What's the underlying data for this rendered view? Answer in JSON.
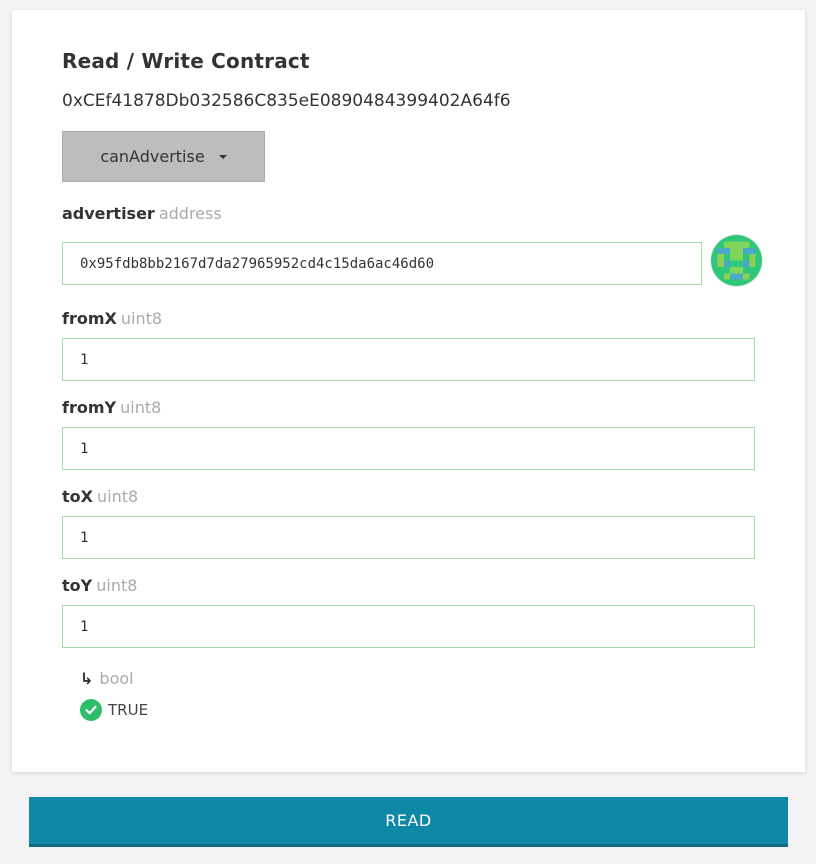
{
  "card": {
    "title": "Read / Write Contract",
    "contract_address": "0xCEf41878Db032586C835eE0890484399402A64f6",
    "function_select": "canAdvertise"
  },
  "params": [
    {
      "name": "advertiser",
      "type": "address",
      "value": "0x95fdb8bb2167d7da27965952cd4c15da6ac46d60"
    },
    {
      "name": "fromX",
      "type": "uint8",
      "value": "1"
    },
    {
      "name": "fromY",
      "type": "uint8",
      "value": "1"
    },
    {
      "name": "toX",
      "type": "uint8",
      "value": "1"
    },
    {
      "name": "toY",
      "type": "uint8",
      "value": "1"
    }
  ],
  "output": {
    "arrow": "↳",
    "type": "bool",
    "value": "TRUE"
  },
  "read_button": "READ",
  "colors": {
    "field_border": "#a6dfa6",
    "button_bg": "#0e88a4",
    "check_green": "#2cbe6a",
    "select_bg": "#bdbdbd"
  },
  "icons": [
    "caret-down-icon",
    "identicon",
    "check-circle-icon"
  ]
}
